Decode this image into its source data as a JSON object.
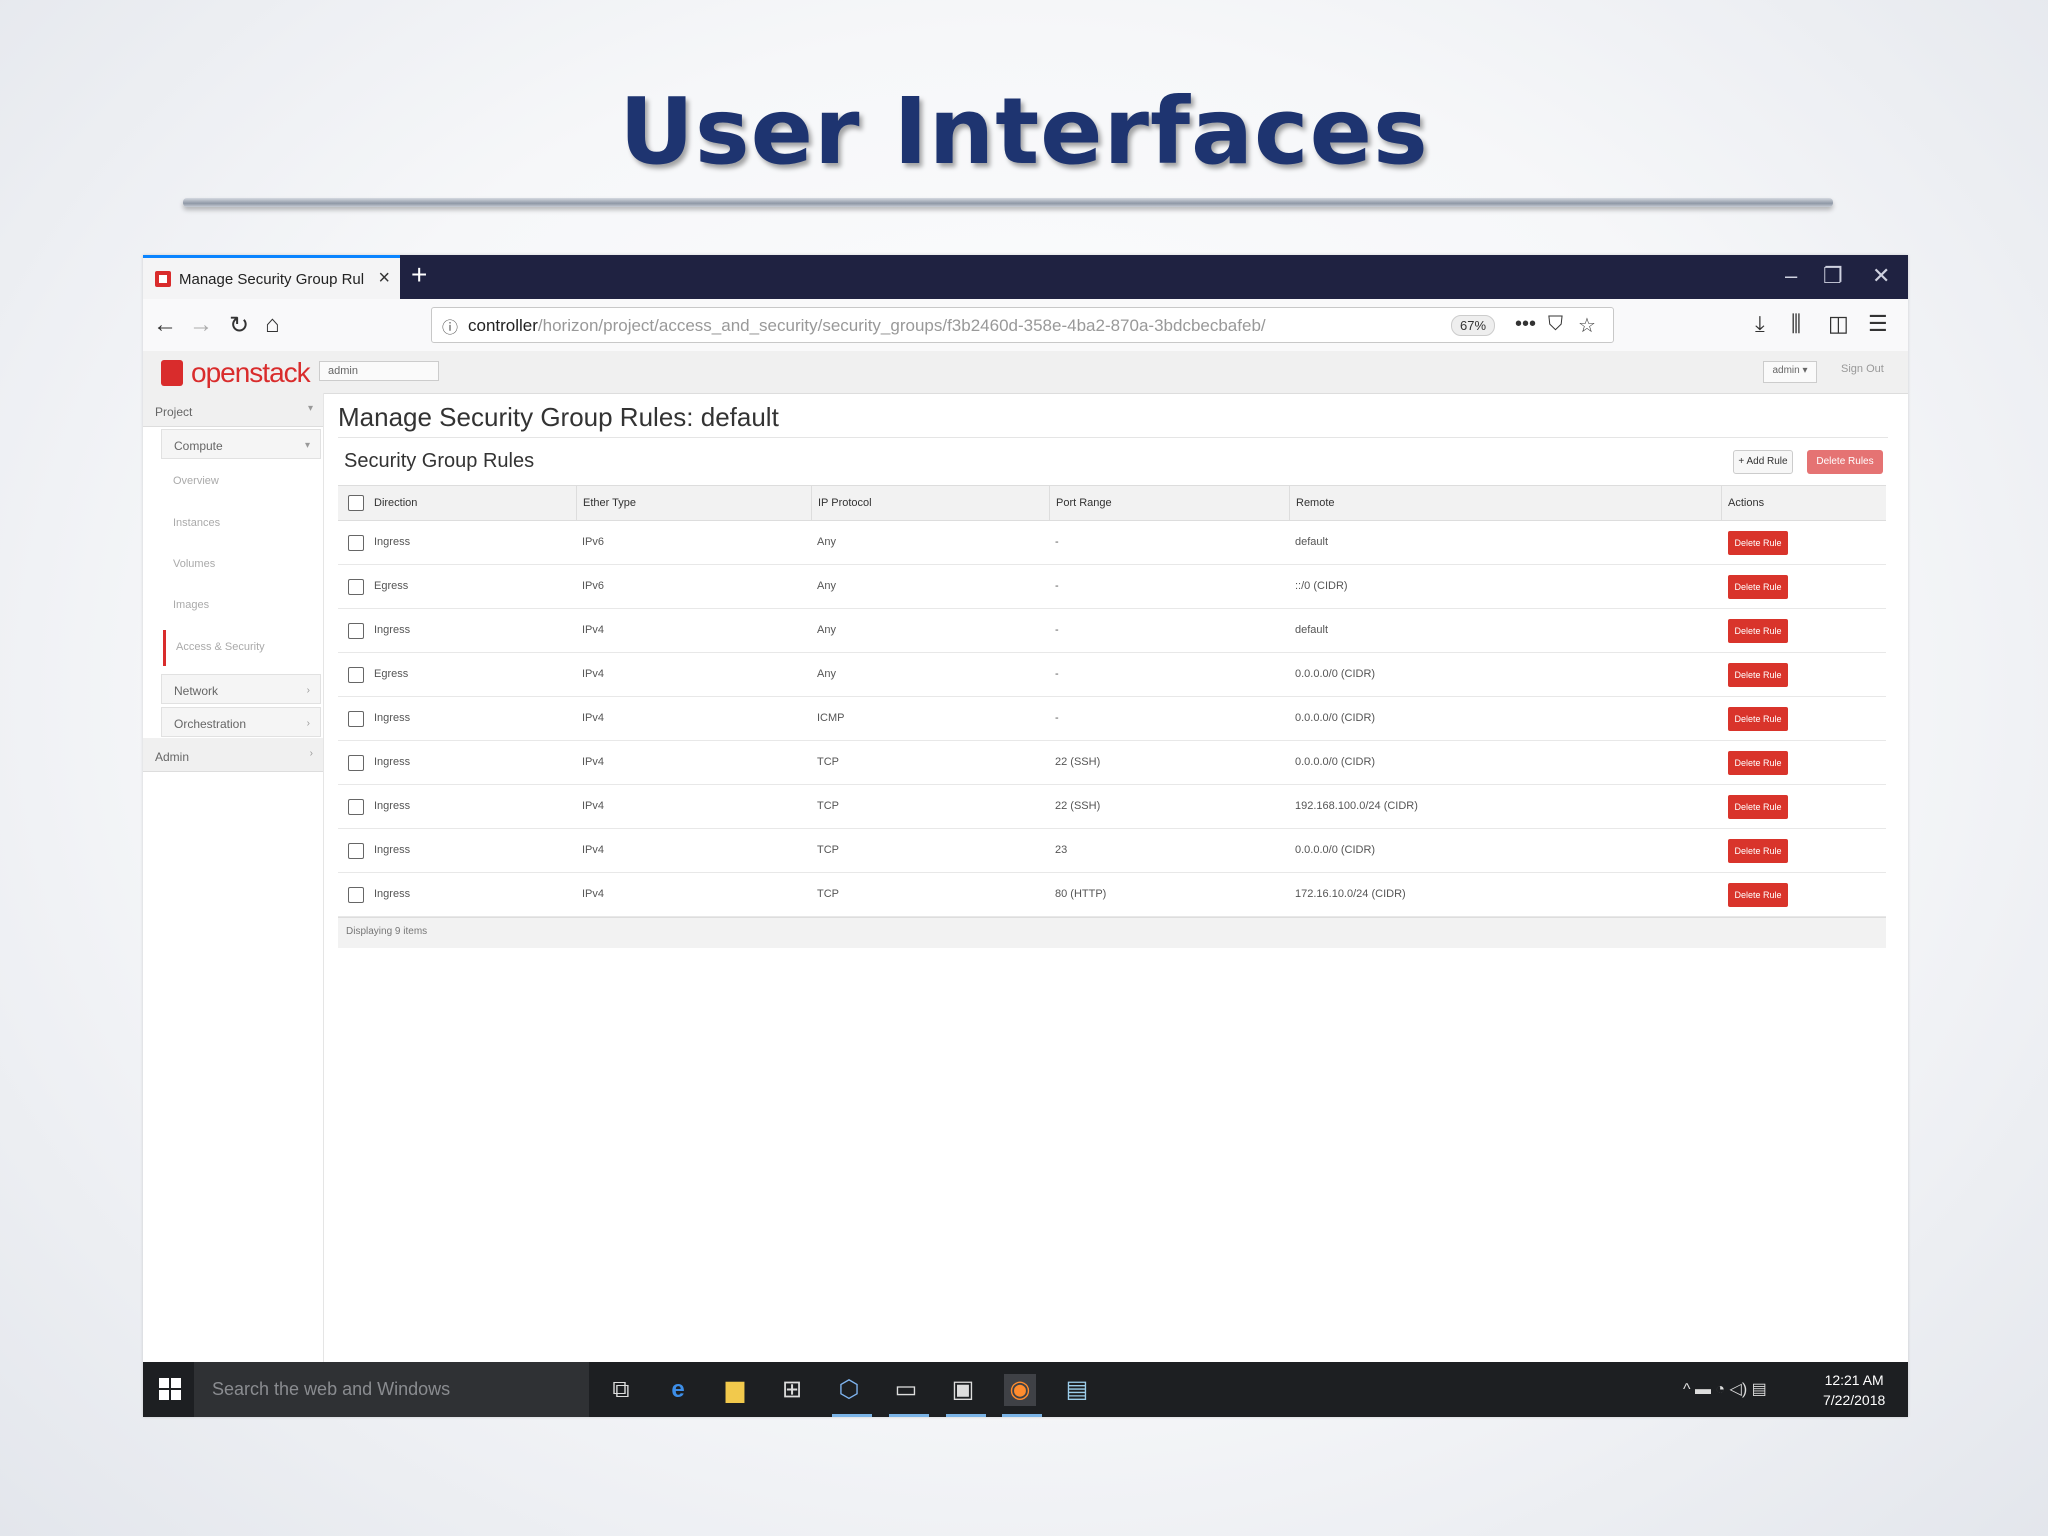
{
  "slide": {
    "title": "User Interfaces"
  },
  "browser": {
    "tab_title": "Manage Security Group Rules",
    "tab_close": "×",
    "new_tab": "+",
    "window_controls": {
      "minimize": "–",
      "restore": "❐",
      "close": "✕"
    },
    "nav": {
      "back": "←",
      "forward": "→",
      "reload": "↻",
      "home": "⌂"
    },
    "url_host": "controller",
    "url_path": "/horizon/project/access_and_security/security_groups/f3b2460d-358e-4ba2-870a-3bdcbecbafeb/",
    "zoom": "67%",
    "url_icons": {
      "more": "•••",
      "pocket": "⛉",
      "bookmark": "☆"
    },
    "toolbar_icons": {
      "download": "⤓",
      "library": "⫼",
      "sidebar": "◫",
      "menu": "☰"
    }
  },
  "openstack": {
    "logo_text": "openstack",
    "project_selector": "admin",
    "user_menu": "admin ▾",
    "sign_out": "Sign Out"
  },
  "sidebar": {
    "project": "Project",
    "compute": "Compute",
    "links": [
      "Overview",
      "Instances",
      "Volumes",
      "Images"
    ],
    "active": "Access & Security",
    "network": "Network",
    "orchestration": "Orchestration",
    "admin": "Admin"
  },
  "main": {
    "page_title": "Manage Security Group Rules: default",
    "table_title": "Security Group Rules",
    "add_rule": "+ Add Rule",
    "delete_rules": "Delete Rules",
    "columns": [
      "Direction",
      "Ether Type",
      "IP Protocol",
      "Port Range",
      "Remote",
      "Actions"
    ],
    "rows": [
      {
        "direction": "Ingress",
        "ether": "IPv6",
        "protocol": "Any",
        "port": "-",
        "remote": "default",
        "action": "Delete Rule"
      },
      {
        "direction": "Egress",
        "ether": "IPv6",
        "protocol": "Any",
        "port": "-",
        "remote": "::/0 (CIDR)",
        "action": "Delete Rule"
      },
      {
        "direction": "Ingress",
        "ether": "IPv4",
        "protocol": "Any",
        "port": "-",
        "remote": "default",
        "action": "Delete Rule"
      },
      {
        "direction": "Egress",
        "ether": "IPv4",
        "protocol": "Any",
        "port": "-",
        "remote": "0.0.0.0/0 (CIDR)",
        "action": "Delete Rule"
      },
      {
        "direction": "Ingress",
        "ether": "IPv4",
        "protocol": "ICMP",
        "port": "-",
        "remote": "0.0.0.0/0 (CIDR)",
        "action": "Delete Rule"
      },
      {
        "direction": "Ingress",
        "ether": "IPv4",
        "protocol": "TCP",
        "port": "22 (SSH)",
        "remote": "0.0.0.0/0 (CIDR)",
        "action": "Delete Rule"
      },
      {
        "direction": "Ingress",
        "ether": "IPv4",
        "protocol": "TCP",
        "port": "22 (SSH)",
        "remote": "192.168.100.0/24 (CIDR)",
        "action": "Delete Rule"
      },
      {
        "direction": "Ingress",
        "ether": "IPv4",
        "protocol": "TCP",
        "port": "23",
        "remote": "0.0.0.0/0 (CIDR)",
        "action": "Delete Rule"
      },
      {
        "direction": "Ingress",
        "ether": "IPv4",
        "protocol": "TCP",
        "port": "80 (HTTP)",
        "remote": "172.16.10.0/24 (CIDR)",
        "action": "Delete Rule"
      }
    ],
    "footer": "Displaying 9 items"
  },
  "taskbar": {
    "search_placeholder": "Search the web and Windows",
    "clock_time": "12:21 AM",
    "clock_date": "7/22/2018",
    "tray": "^ ▬ ◔ ◁) ▤"
  },
  "colors": {
    "accent_red": "#d9342b",
    "title_blue": "#1e3470",
    "tab_strip": "#1f2241"
  }
}
